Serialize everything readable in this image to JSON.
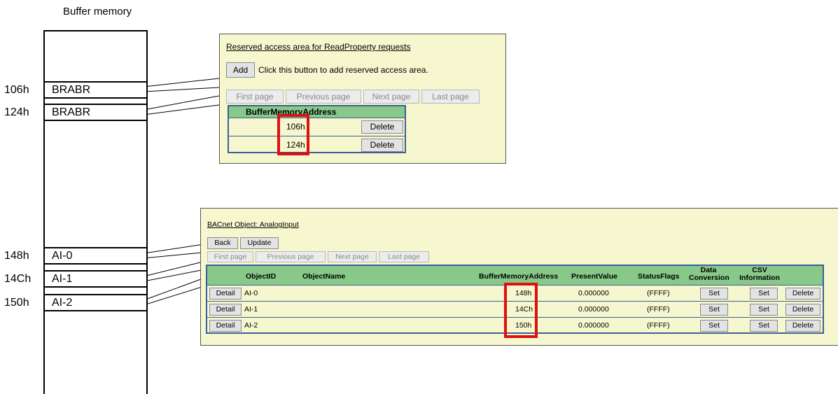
{
  "memory": {
    "title": "Buffer memory",
    "entries": [
      {
        "addr": "106h",
        "label": "BRABR"
      },
      {
        "addr": "124h",
        "label": "BRABR"
      },
      {
        "addr": "148h",
        "label": "AI-0"
      },
      {
        "addr": "14Ch",
        "label": "AI-1"
      },
      {
        "addr": "150h",
        "label": "AI-2"
      }
    ]
  },
  "reserved_panel": {
    "title": "Reserved access area for ReadProperty requests",
    "add_label": "Add",
    "add_hint": "Click this button to add reserved access area.",
    "pager": [
      "First page",
      "Previous page",
      "Next page",
      "Last page"
    ],
    "column": "BufferMemoryAddress",
    "rows": [
      {
        "address": "106h",
        "delete": "Delete"
      },
      {
        "address": "124h",
        "delete": "Delete"
      }
    ]
  },
  "analog_panel": {
    "title": "BACnet Object: AnalogInput",
    "back_label": "Back",
    "update_label": "Update",
    "pager": [
      "First page",
      "Previous page",
      "Next page",
      "Last page"
    ],
    "columns": {
      "object_id": "ObjectID",
      "object_name": "ObjectName",
      "address": "BufferMemoryAddress",
      "present_value": "PresentValue",
      "status_flags": "StatusFlags",
      "data_conversion": "Data Conversion",
      "csv_information": "CSV Information"
    },
    "rows": [
      {
        "detail": "Detail",
        "object_id": "AI-0",
        "address": "148h",
        "present_value": "0.000000",
        "status_flags": "(FFFF)",
        "set1": "Set",
        "set2": "Set",
        "delete": "Delete"
      },
      {
        "detail": "Detail",
        "object_id": "AI-1",
        "address": "14Ch",
        "present_value": "0.000000",
        "status_flags": "(FFFF)",
        "set1": "Set",
        "set2": "Set",
        "delete": "Delete"
      },
      {
        "detail": "Detail",
        "object_id": "AI-2",
        "address": "150h",
        "present_value": "0.000000",
        "status_flags": "(FFFF)",
        "set1": "Set",
        "set2": "Set",
        "delete": "Delete"
      }
    ]
  },
  "colors": {
    "panel_bg": "#f7f7cf",
    "header_bg": "#88c98a",
    "highlight": "#e01010",
    "grid_border": "#3a5f9a"
  }
}
